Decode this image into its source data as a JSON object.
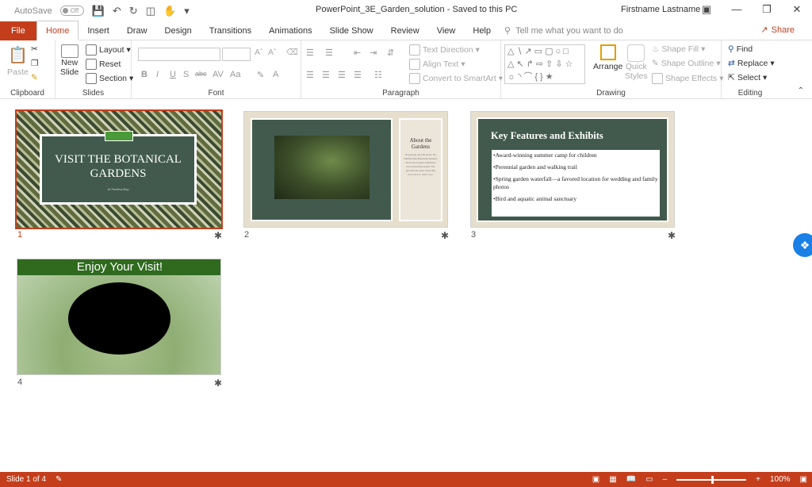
{
  "titlebar": {
    "autosave_label": "AutoSave",
    "autosave_state": "Off",
    "doc_title": "PowerPoint_3E_Garden_solution  -  Saved to this PC",
    "user": "Firstname Lastname"
  },
  "tabs": {
    "file": "File",
    "items": [
      "Home",
      "Insert",
      "Draw",
      "Design",
      "Transitions",
      "Animations",
      "Slide Show",
      "Review",
      "View",
      "Help"
    ],
    "active": "Home",
    "tell_me_placeholder": "Tell me what you want to do",
    "share": "Share"
  },
  "ribbon": {
    "clipboard": {
      "label": "Clipboard",
      "paste": "Paste"
    },
    "slides": {
      "label": "Slides",
      "new_slide": "New",
      "new_slide2": "Slide",
      "layout": "Layout",
      "reset": "Reset",
      "section": "Section"
    },
    "font": {
      "label": "Font"
    },
    "paragraph": {
      "label": "Paragraph",
      "text_direction": "Text Direction",
      "align_text": "Align Text",
      "convert": "Convert to SmartArt"
    },
    "drawing": {
      "label": "Drawing",
      "arrange": "Arrange",
      "quick_styles": "Quick",
      "quick_styles2": "Styles",
      "shape_fill": "Shape Fill",
      "shape_outline": "Shape Outline",
      "shape_effects": "Shape Effects"
    },
    "editing": {
      "label": "Editing",
      "find": "Find",
      "replace": "Replace",
      "select": "Select"
    }
  },
  "slides": [
    {
      "number": "1",
      "title": "VISIT THE BOTANICAL GARDENS",
      "subtitle": "At Pacifica Bay"
    },
    {
      "number": "2",
      "side_title": "About the Gardens",
      "side_body": "Occupying over 60 acres, the Pacifica Bay Botanical Gardens are home to plant collections from around the world. The grounds are open every day from 10 a.m. until 7 p.m."
    },
    {
      "number": "3",
      "title": "Key Features and Exhibits",
      "bullets": [
        "Award-winning summer camp for children",
        "Perennial garden and walking trail",
        "Spring garden waterfall—a favored location for wedding and family photos",
        "Bird and aquatic animal sanctuary"
      ]
    },
    {
      "number": "4",
      "title": "Enjoy Your Visit!"
    }
  ],
  "status": {
    "slide_info": "Slide 1 of 4",
    "zoom": "100%"
  }
}
